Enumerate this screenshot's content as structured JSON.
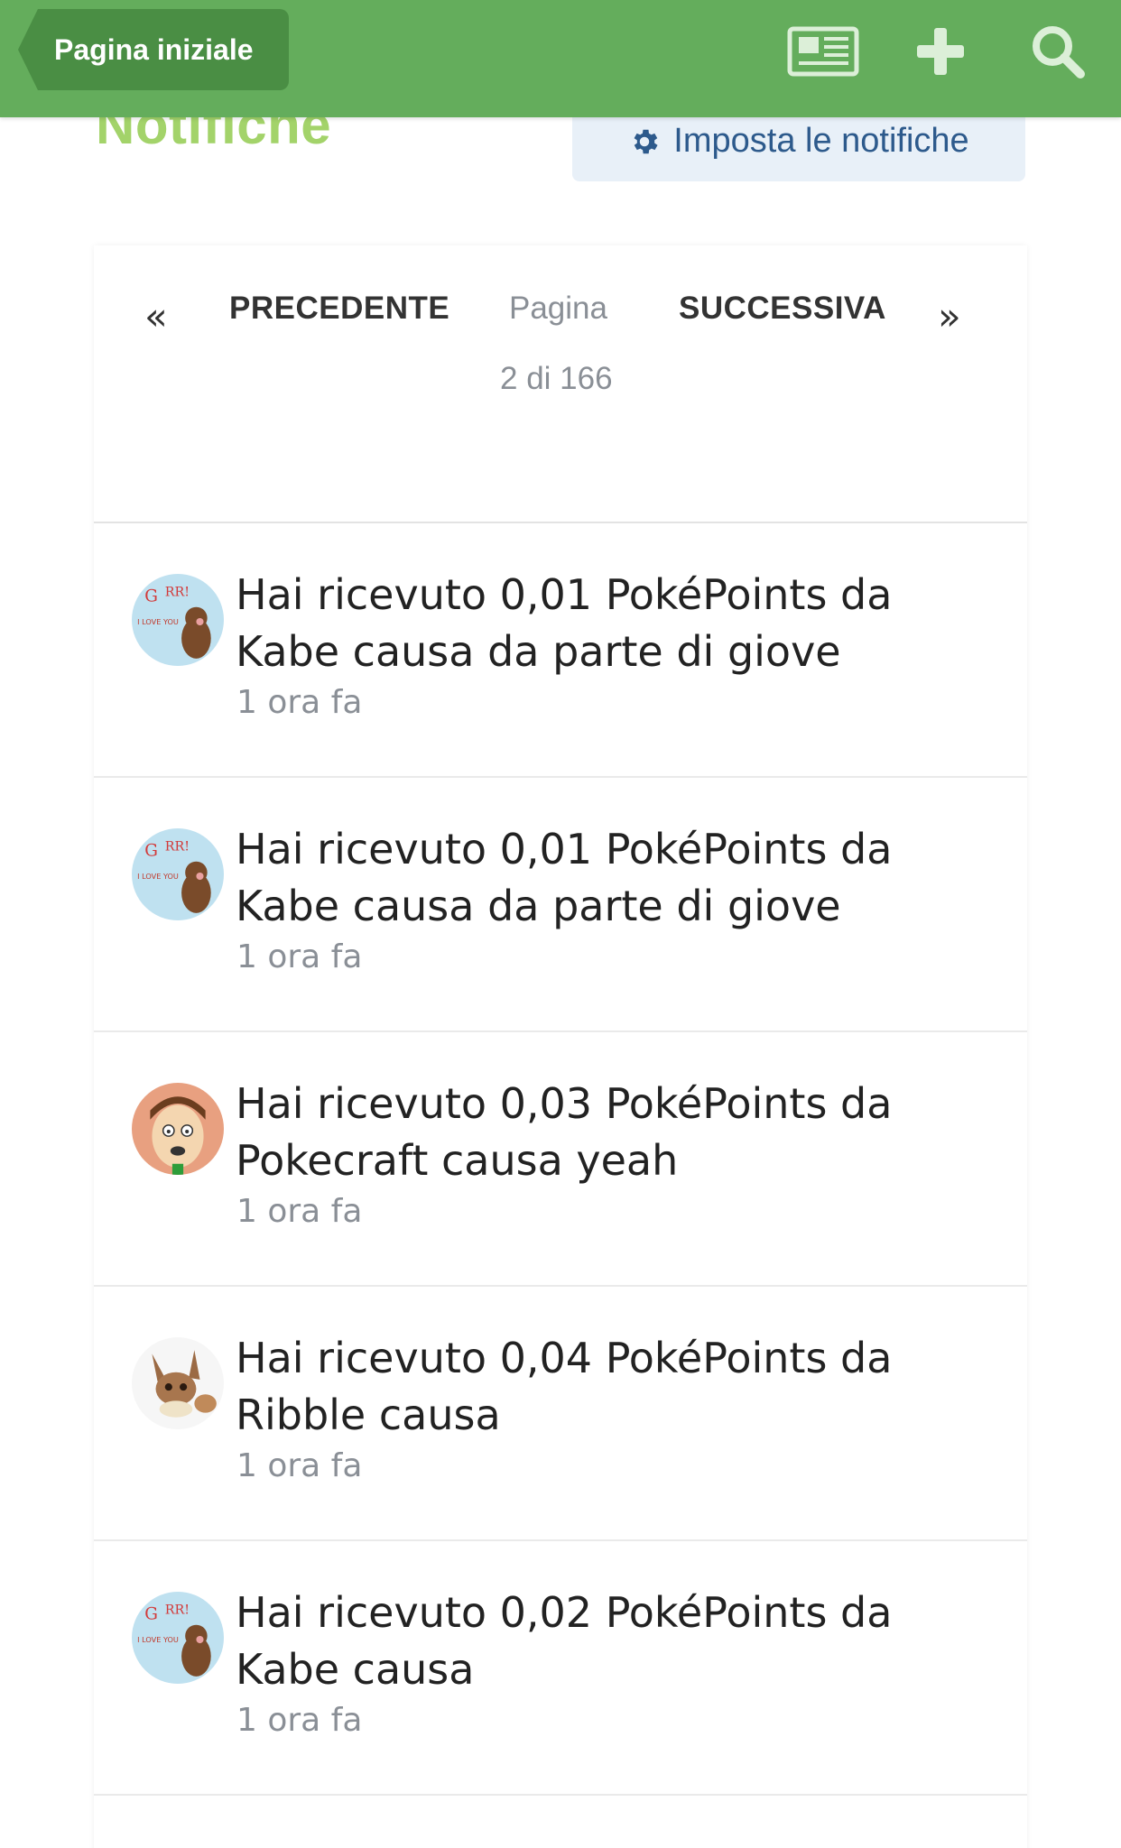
{
  "header": {
    "home_label": "Pagina iniziale",
    "background": "#64ad5c",
    "icons": [
      "news-icon",
      "plus-icon",
      "search-icon"
    ]
  },
  "page": {
    "title": "Notifiche",
    "settings_label": "Imposta le notifiche",
    "title_color": "#a3d36a"
  },
  "pager": {
    "prev_label": "PRECEDENTE",
    "page_label": "Pagina",
    "page_of": "2 di 166",
    "next_label": "SUCCESSIVA"
  },
  "notifications": [
    {
      "text": "Hai ricevuto 0,01 PokéPoints da Kabe causa da parte di giove",
      "time": "1 ora fa",
      "avatar": "bear-avatar"
    },
    {
      "text": "Hai ricevuto 0,01 PokéPoints da Kabe causa da parte di giove",
      "time": "1 ora fa",
      "avatar": "bear-avatar"
    },
    {
      "text": "Hai ricevuto 0,03 PokéPoints da Pokecraft causa yeah",
      "time": "1 ora fa",
      "avatar": "cartoon-face-avatar"
    },
    {
      "text": "Hai ricevuto 0,04 PokéPoints da Ribble causa",
      "time": "1 ora fa",
      "avatar": "eevee-avatar"
    },
    {
      "text": "Hai ricevuto 0,02 PokéPoints da Kabe causa",
      "time": "1 ora fa",
      "avatar": "bear-avatar"
    }
  ]
}
